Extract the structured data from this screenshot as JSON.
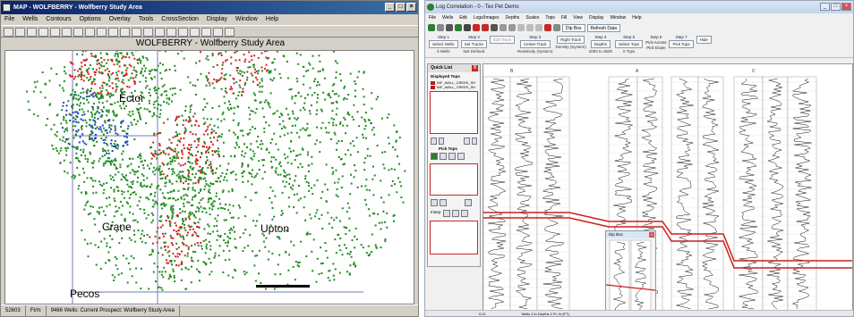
{
  "map_window": {
    "title": "MAP - WOLFBERRY - Wolfberry Study Area",
    "menu": [
      "File",
      "Wells",
      "Contours",
      "Options",
      "Overlay",
      "Tools",
      "CrossSection",
      "Display",
      "Window",
      "Help"
    ],
    "map_title": "WOLFBERRY - Wolfberry Study Area",
    "county_labels": [
      {
        "text": "Ector"
      },
      {
        "text": "Crane"
      },
      {
        "text": "Upton"
      },
      {
        "text": "Pecos"
      }
    ],
    "status": [
      "52603",
      "Ft/m",
      "9466 Wells: Current Prospect: Wolfberry Study Area"
    ],
    "colors": {
      "well_green": "#1e8c1e",
      "well_red": "#d62020",
      "well_blue": "#1e3cc8",
      "boundary": "#7a7ab4"
    }
  },
  "log_window": {
    "title": "Log Correlation - 0 - Tex Pet Demo",
    "menu": [
      "File",
      "Wells",
      "Edit",
      "Logs/Images",
      "Depths",
      "Scales",
      "Tops",
      "Fill",
      "View",
      "Display",
      "Window",
      "Help"
    ],
    "toolbar_buttons": [
      "Dip Box",
      "Refresh Data"
    ],
    "steps": [
      {
        "label": "Step 1",
        "button": "Select Wells",
        "value": "3 Wells"
      },
      {
        "label": "Step 2",
        "button": "Set Tracks",
        "value": "Not Defined"
      },
      {
        "label": "",
        "button": "Edit Track",
        "value": ""
      },
      {
        "label": "Step 3",
        "button": "Center Track",
        "value": "Resistivity (System)"
      },
      {
        "label": "",
        "button": "Right Track",
        "value": "Density (System)"
      },
      {
        "label": "Step 4",
        "button": "Depths",
        "value": "2000 to 3500"
      },
      {
        "label": "Step 5",
        "button": "Select Tops",
        "value": "0 Tops"
      },
      {
        "label": "Step 6",
        "button": "Pick Across",
        "value": "Pick Down"
      },
      {
        "label": "Step 7",
        "button": "Pick Tops",
        "value": ""
      },
      {
        "label": "",
        "button": "Hide",
        "value": ""
      }
    ],
    "quick_list": {
      "title": "Quick List",
      "displayed_tops_label": "Displayed Tops",
      "tops": [
        "INF_WALL_CREEK_SH",
        "INF_WALL_CREEK_SH"
      ],
      "pick_tops_label": "Pick Tops",
      "interp_label": "Interp"
    },
    "dip_box_title": "Dip Box",
    "well_headers": [
      "B",
      "A",
      "C"
    ],
    "status": [
      "0:11",
      "Wells 2 in Depths 2 Ft, In (FT)"
    ],
    "colors": {
      "correlation_line": "#cc1f1f",
      "curve": "#111111"
    }
  }
}
